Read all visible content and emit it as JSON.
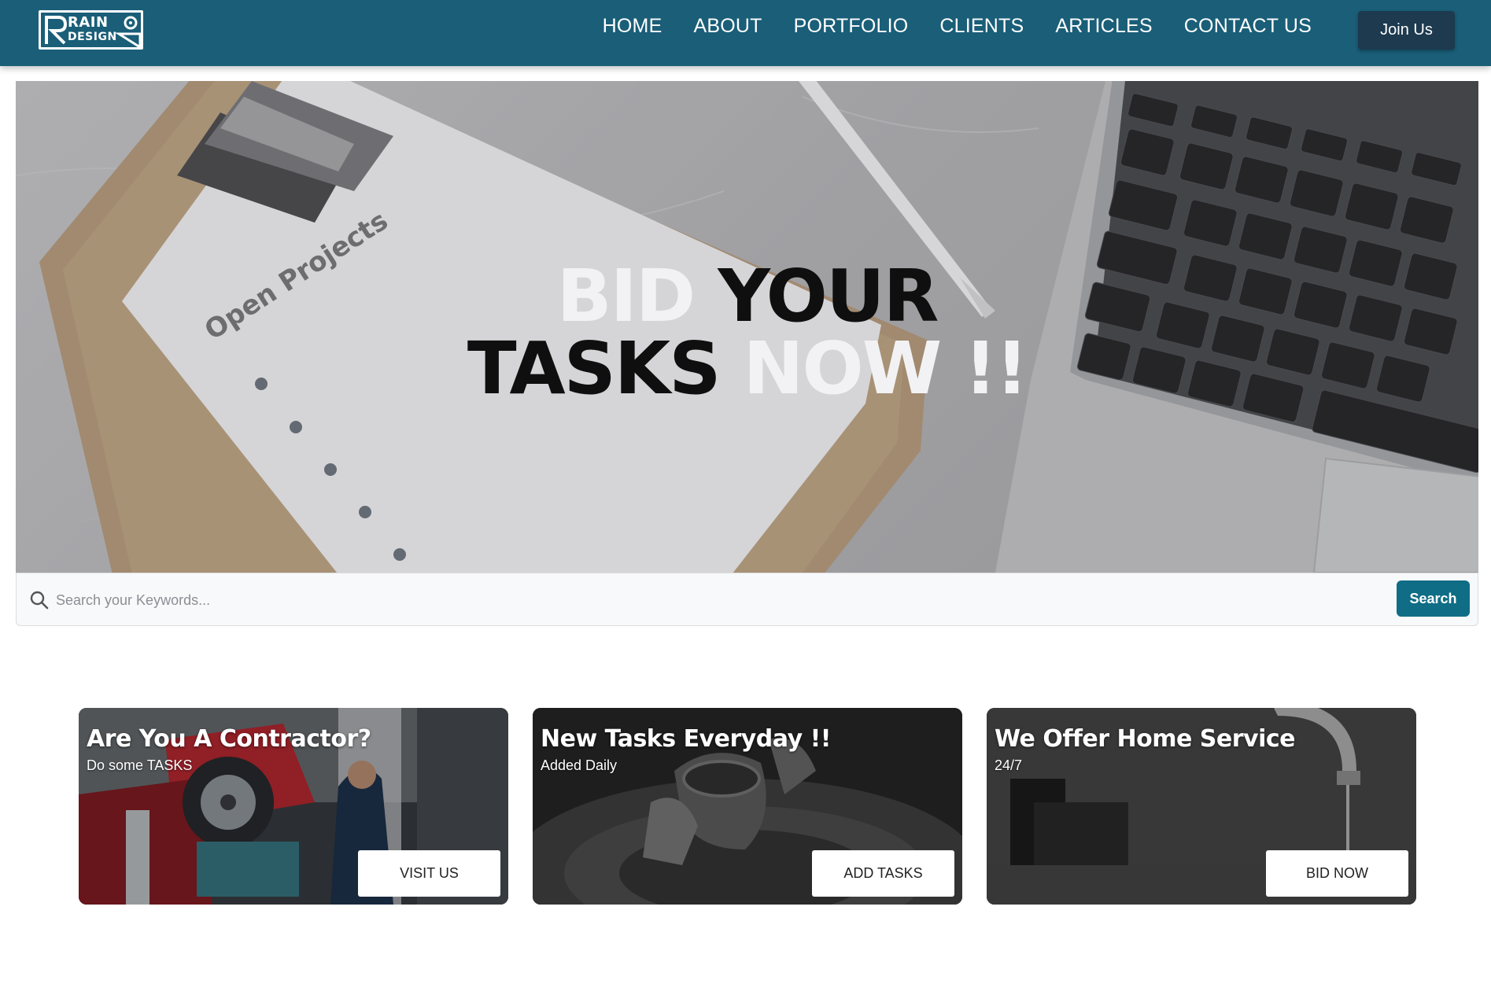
{
  "brand": {
    "logo_line1": "RAIN",
    "logo_line2": "DESIGN",
    "primary_color": "#1a5e78",
    "button_dark": "#1d3a4f",
    "accent": "#0f6d86"
  },
  "nav": {
    "items": [
      {
        "label": "HOME"
      },
      {
        "label": "ABOUT"
      },
      {
        "label": "PORTFOLIO"
      },
      {
        "label": "CLIENTS"
      },
      {
        "label": "ARTICLES"
      },
      {
        "label": "CONTACT US"
      }
    ],
    "join_label": "Join Us"
  },
  "hero": {
    "line1_light": "BID",
    "line1_dark": "YOUR",
    "line2_dark": "TASKS",
    "line2_light": "NOW !!",
    "clipboard_text": "Open Projects"
  },
  "search": {
    "placeholder": "Search your Keywords...",
    "button_label": "Search"
  },
  "cards": [
    {
      "title": "Are You A Contractor?",
      "subtitle": "Do some TASKS",
      "button": "VISIT US"
    },
    {
      "title": "New Tasks Everyday !!",
      "subtitle": "Added Daily",
      "button": "ADD TASKS"
    },
    {
      "title": "We Offer Home Service",
      "subtitle": "24/7",
      "button": "BID NOW"
    }
  ]
}
